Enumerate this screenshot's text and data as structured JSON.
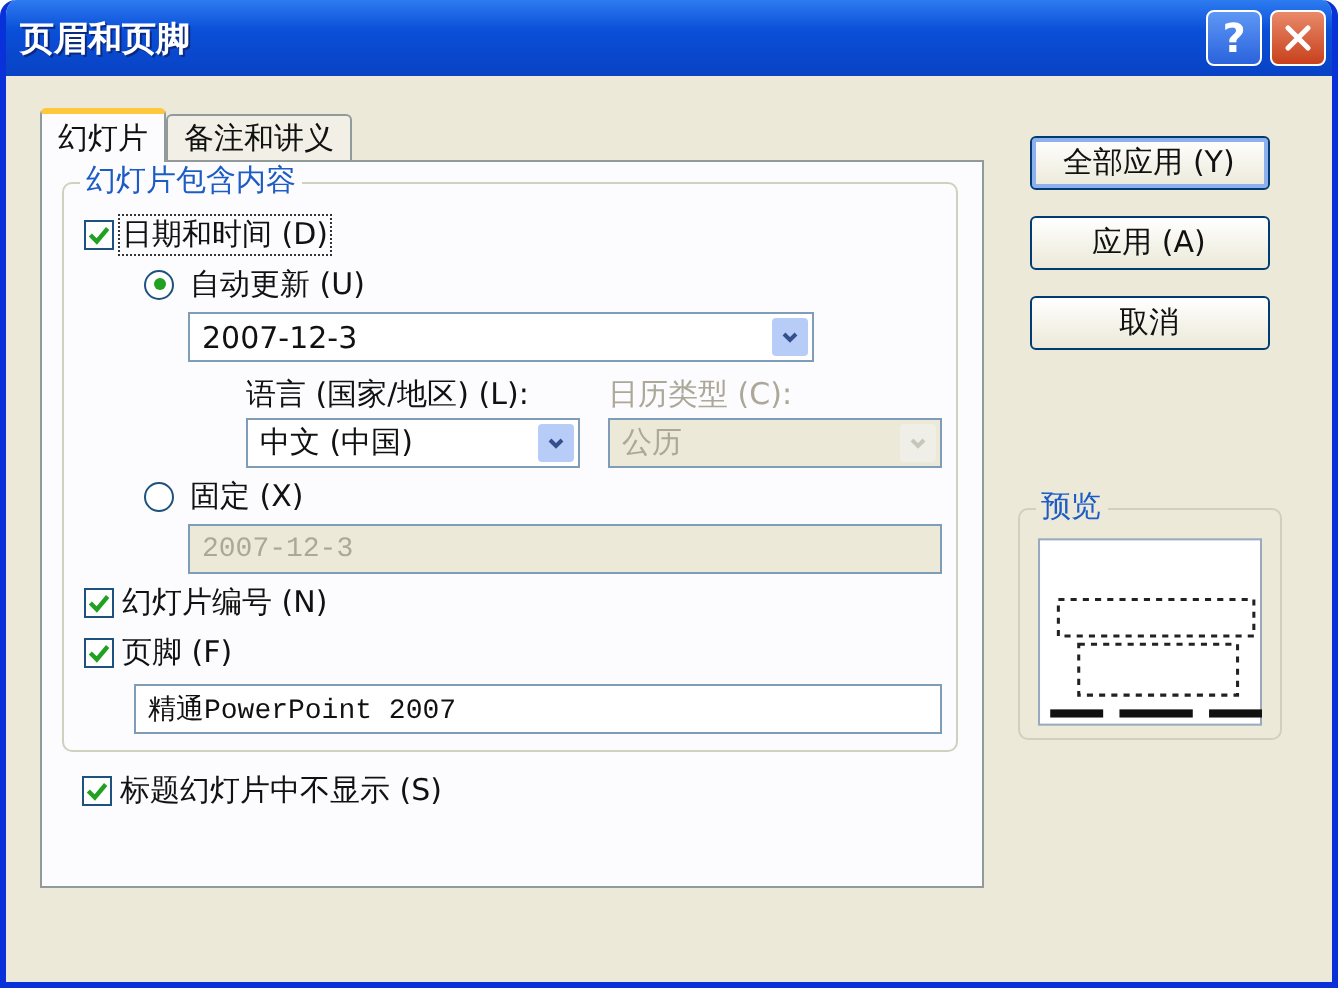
{
  "window": {
    "title": "页眉和页脚",
    "help": "?"
  },
  "tabs": [
    {
      "label": "幻灯片",
      "selected": true
    },
    {
      "label": "备注和讲义",
      "selected": false
    }
  ],
  "group": {
    "title": "幻灯片包含内容"
  },
  "date_time": {
    "label": "日期和时间 (D)",
    "checked": true
  },
  "date_modes": [
    {
      "kind": "dropdown",
      "label": "自动更新 (U)",
      "selected": true,
      "value": "2007-12-3",
      "disabled": false
    },
    {
      "kind": "text",
      "label": "固定 (X)",
      "selected": false,
      "value": "2007-12-3",
      "disabled": true
    }
  ],
  "language": {
    "label": "语言 (国家/地区) (L):",
    "value": "中文 (中国)",
    "disabled": false
  },
  "calendar": {
    "label": "日历类型 (C):",
    "value": "公历",
    "disabled": true
  },
  "slide_number": {
    "label": "幻灯片编号 (N)",
    "checked": true
  },
  "footer": {
    "label": "页脚 (F)",
    "checked": true,
    "value": "精通PowerPoint 2007"
  },
  "hide_on_title": {
    "label": "标题幻灯片中不显示 (S)",
    "checked": true
  },
  "buttons": [
    {
      "label": "全部应用 (Y)",
      "default": true
    },
    {
      "label": "应用 (A)",
      "default": false
    },
    {
      "label": "取消",
      "default": false
    }
  ],
  "preview": {
    "title": "预览"
  }
}
